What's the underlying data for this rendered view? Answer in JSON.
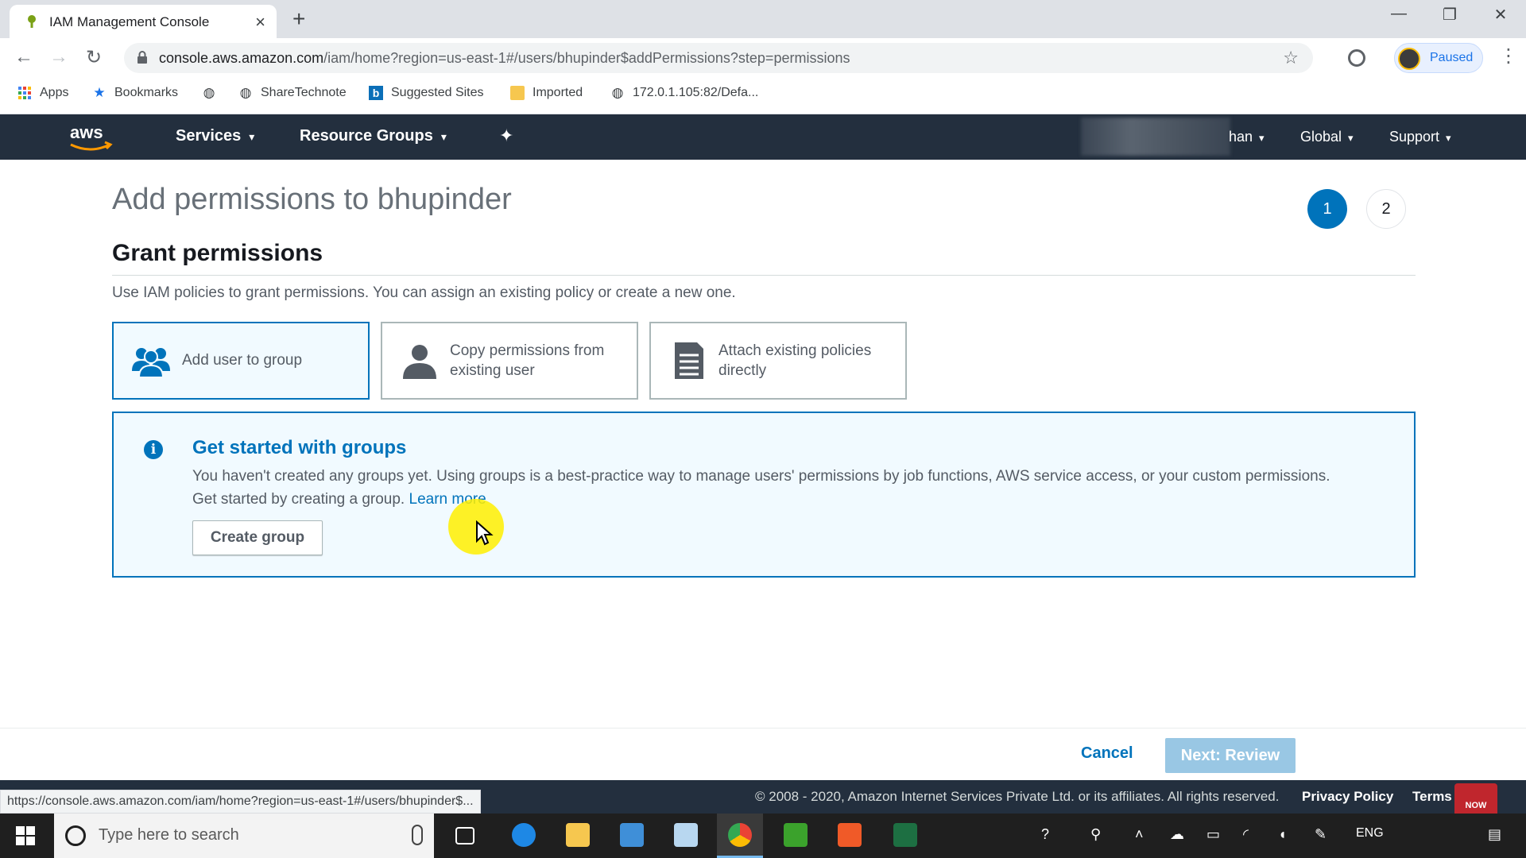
{
  "browser": {
    "tab_title": "IAM Management Console",
    "url_host": "console.aws.amazon.com",
    "url_path": "/iam/home?region=us-east-1#/users/bhupinder$addPermissions?step=permissions",
    "profile_label": "Paused",
    "bookmarks": [
      {
        "label": "Apps",
        "icon": "apps-grid-icon"
      },
      {
        "label": "Bookmarks",
        "icon": "star-icon"
      },
      {
        "label": "",
        "icon": "globe-icon"
      },
      {
        "label": "ShareTechnote",
        "icon": "globe-icon"
      },
      {
        "label": "Suggested Sites",
        "icon": "bing-icon"
      },
      {
        "label": "Imported",
        "icon": "folder-icon"
      },
      {
        "label": "172.0.1.105:82/Defa...",
        "icon": "globe-icon"
      }
    ],
    "status_url": "https://console.aws.amazon.com/iam/home?region=us-east-1#/users/bhupinder$..."
  },
  "aws_nav": {
    "services": "Services",
    "resource_groups": "Resource Groups",
    "account_suffix": "han",
    "region": "Global",
    "support": "Support"
  },
  "page": {
    "title": "Add permissions to bhupinder",
    "steps": [
      "1",
      "2"
    ],
    "active_step": 1,
    "section_title": "Grant permissions",
    "section_desc": "Use IAM policies to grant permissions. You can assign an existing policy or create a new one.",
    "options": [
      {
        "line1": "Add user to group",
        "line2": "",
        "selected": true
      },
      {
        "line1": "Copy permissions from",
        "line2": "existing user",
        "selected": false
      },
      {
        "line1": "Attach existing policies",
        "line2": "directly",
        "selected": false
      }
    ],
    "info": {
      "title": "Get started with groups",
      "text1": "You haven't created any groups yet. Using groups is a best-practice way to manage users' permissions by job functions, AWS service access, or your custom permissions.",
      "text2": "Get started by creating a group.",
      "link": "Learn more",
      "button": "Create group"
    },
    "cancel": "Cancel",
    "next": "Next: Review"
  },
  "footer": {
    "copyright": "© 2008 - 2020, Amazon Internet Services Private Ltd. or its affiliates. All rights reserved.",
    "privacy": "Privacy Policy",
    "terms": "Terms",
    "badge": "NOW"
  },
  "taskbar": {
    "search_placeholder": "Type here to search",
    "lang": "ENG"
  },
  "colors": {
    "aws_nav": "#232f3e",
    "accent": "#0073bb",
    "info_bg": "#f1faff",
    "next_disabled": "#99c7e4"
  }
}
